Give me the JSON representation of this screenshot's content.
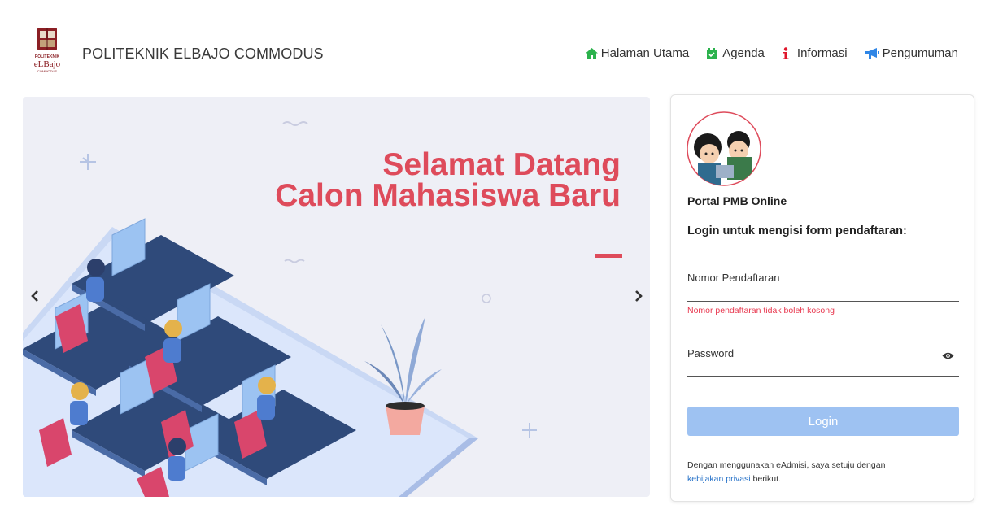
{
  "header": {
    "brand": "POLITEKNIK ELBAJO COMMODUS",
    "logo_text_top": "POLITEKNIK",
    "logo_text_main": "eLBajo",
    "logo_text_bottom": "COMMODUS",
    "nav": [
      {
        "label": "Halaman Utama",
        "icon": "home-icon"
      },
      {
        "label": "Agenda",
        "icon": "calendar-icon"
      },
      {
        "label": "Informasi",
        "icon": "info-icon"
      },
      {
        "label": "Pengumuman",
        "icon": "megaphone-icon"
      }
    ]
  },
  "hero": {
    "line1": "Selamat Datang",
    "line2": "Calon Mahasiswa Baru",
    "prev_icon": "chevron-left-icon",
    "next_icon": "chevron-right-icon"
  },
  "login": {
    "portal_title": "Portal PMB Online",
    "subtitle": "Login untuk mengisi form pendaftaran:",
    "nomor_placeholder": "Nomor Pendaftaran",
    "nomor_value": "",
    "nomor_error": "Nomor pendaftaran tidak boleh kosong",
    "password_placeholder": "Password",
    "password_value": "",
    "login_button": "Login",
    "note_prefix": "Dengan menggunakan eAdmisi, saya setuju dengan",
    "note_link": "kebijakan privasi",
    "note_suffix": "berikut."
  },
  "colors": {
    "accent_red": "#de4b5b",
    "nav_green": "#2bb24c",
    "info_red": "#e0162b",
    "megaphone_blue": "#2f86e6",
    "login_button": "#9ec2f2",
    "error": "#e8384f",
    "link": "#2a74c9"
  }
}
